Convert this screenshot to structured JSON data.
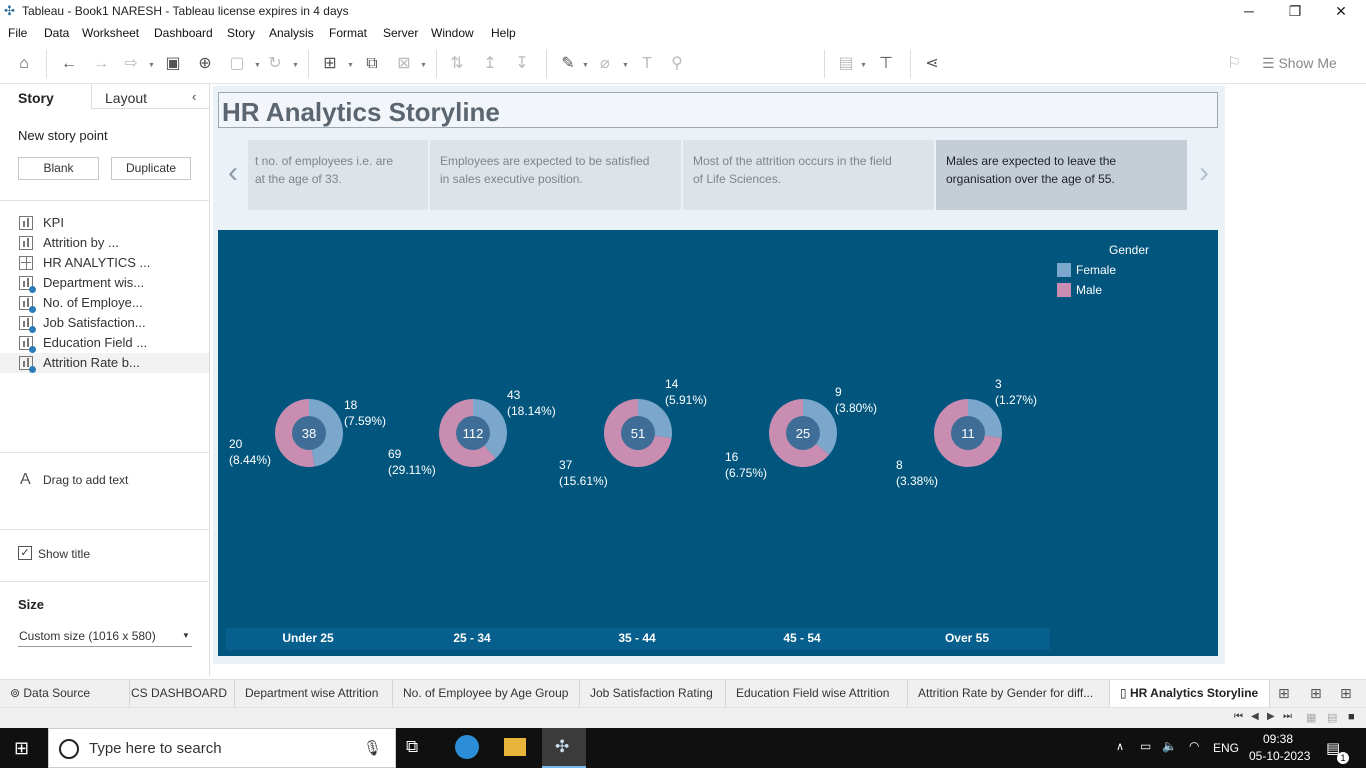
{
  "window": {
    "title": "Tableau - Book1 NARESH - Tableau license expires in 4 days",
    "minimize": "─",
    "restore": "❐",
    "close": "✕"
  },
  "menu": [
    "File",
    "Data",
    "Worksheet",
    "Dashboard",
    "Story",
    "Analysis",
    "Format",
    "Server",
    "Window",
    "Help"
  ],
  "toolbar": {
    "show_me": "Show Me"
  },
  "left_panel": {
    "tab_story": "Story",
    "tab_layout": "Layout",
    "new_story_point": "New story point",
    "blank_button": "Blank",
    "duplicate_button": "Duplicate",
    "sheets": [
      "KPI",
      "Attrition by ...",
      "HR ANALYTICS ...",
      "Department wis...",
      "No. of Employe...",
      "Job Satisfaction...",
      "Education Field ...",
      "Attrition Rate b..."
    ],
    "drag_text": "Drag to add text",
    "show_title": "Show title",
    "size_label": "Size",
    "size_value": "Custom size (1016 x 580)"
  },
  "story": {
    "title": "HR Analytics Storyline",
    "captions": [
      {
        "line1": "t no. of employees i.e. are",
        "line2": "at the age of 33."
      },
      {
        "line1": "Employees are expected to be satisfied",
        "line2": "in sales executive position."
      },
      {
        "line1": "Most of the attrition occurs in the field",
        "line2": "of Life Sciences."
      },
      {
        "line1": "Males are expected to leave the",
        "line2": "organisation over the age of 55."
      }
    ]
  },
  "chart_data": {
    "type": "pie",
    "legend_title": "Gender",
    "legend": [
      {
        "name": "Female",
        "color": "#7ba7cc"
      },
      {
        "name": "Male",
        "color": "#c98db2"
      }
    ],
    "categories": [
      "Under 25",
      "25 - 34",
      "35 - 44",
      "45 - 54",
      "Over 55"
    ],
    "totals": [
      "38",
      "112",
      "51",
      "25",
      "11"
    ],
    "female": [
      {
        "count": "18",
        "pct": "(7.59%)",
        "value": 18
      },
      {
        "count": "43",
        "pct": "(18.14%)",
        "value": 43
      },
      {
        "count": "14",
        "pct": "(5.91%)",
        "value": 14
      },
      {
        "count": "9",
        "pct": "(3.80%)",
        "value": 9
      },
      {
        "count": "3",
        "pct": "(1.27%)",
        "value": 3
      }
    ],
    "male": [
      {
        "count": "20",
        "pct": "(8.44%)",
        "value": 20
      },
      {
        "count": "69",
        "pct": "(29.11%)",
        "value": 69
      },
      {
        "count": "37",
        "pct": "(15.61%)",
        "value": 37
      },
      {
        "count": "16",
        "pct": "(6.75%)",
        "value": 16
      },
      {
        "count": "8",
        "pct": "(3.38%)",
        "value": 8
      }
    ],
    "colors": {
      "background": "#02567e",
      "center": "#3e6e97"
    }
  },
  "sheet_tabs": {
    "data_source": "Data Source",
    "tabs": [
      "CS DASHBOARD",
      "Department wise Attrition",
      "No. of Employee by Age Group",
      "Job Satisfaction Rating",
      "Education Field wise Attrition",
      "Attrition Rate by Gender for diff...",
      "HR Analytics Storyline"
    ]
  },
  "taskbar": {
    "search_placeholder": "Type here to search",
    "lang": "ENG",
    "time": "09:38",
    "date": "05-10-2023",
    "notif": "1"
  }
}
